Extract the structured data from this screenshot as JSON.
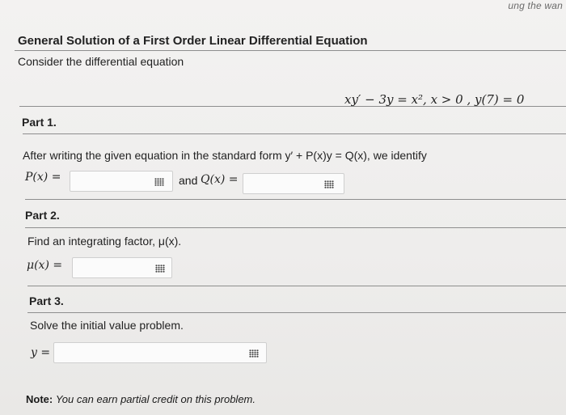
{
  "top_partial_text": "ung the wan",
  "title": "General Solution of a First Order Linear Differential Equation",
  "intro": "Consider the differential equation",
  "equation": "xy′ − 3y = x², x > 0 , y(7) = 0",
  "part1": {
    "heading": "Part 1.",
    "text": "After writing the given equation in the standard form y′ + P(x)y = Q(x), we identify",
    "p_label": "P(x) =",
    "and_label": "and",
    "q_label": "Q(x) ="
  },
  "part2": {
    "heading": "Part 2.",
    "text": "Find an integrating factor, μ(x).",
    "mu_label": "μ(x) ="
  },
  "part3": {
    "heading": "Part 3.",
    "text": "Solve the initial value problem.",
    "y_label": "y ="
  },
  "note": {
    "bold": "Note:",
    "text": "You can earn partial credit on this problem."
  },
  "icons": {
    "math_palette": "grid-icon"
  }
}
